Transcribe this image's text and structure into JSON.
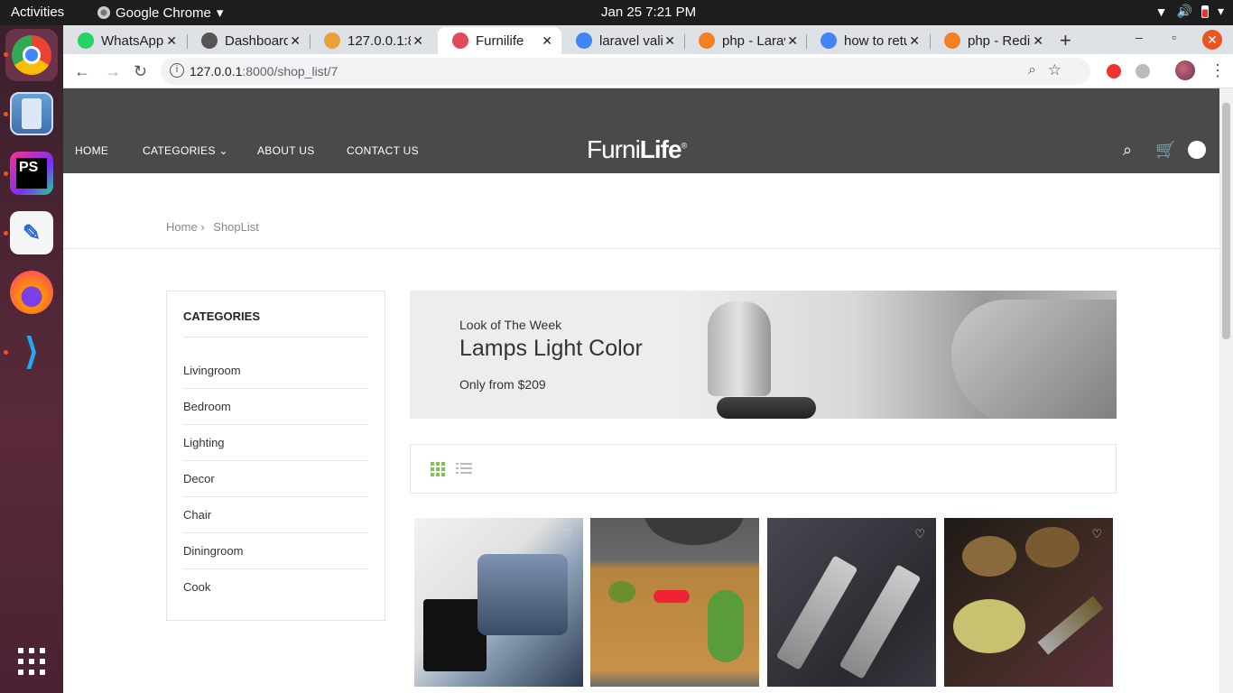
{
  "os": {
    "activities": "Activities",
    "app_name": "Google Chrome",
    "clock": "Jan 25   7:21 PM"
  },
  "browser": {
    "tabs": [
      {
        "title": "WhatsApp",
        "color": "#25d366"
      },
      {
        "title": "Dashboard",
        "color": "#555555"
      },
      {
        "title": "127.0.0.1:8",
        "color": "#e8a23a"
      },
      {
        "title": "Furnilife",
        "color": "#e04a5a",
        "active": true
      },
      {
        "title": "laravel valid",
        "color": "#4285f4"
      },
      {
        "title": "php - Larav",
        "color": "#f48024"
      },
      {
        "title": "how to retu",
        "color": "#4285f4"
      },
      {
        "title": "php - Redir",
        "color": "#f48024"
      }
    ],
    "url_host": "127.0.0.1",
    "url_path": ":8000/shop_list/7"
  },
  "site": {
    "nav": {
      "home": "HOME",
      "categories": "CATEGORIES",
      "about": "ABOUT US",
      "contact": "CONTACT US"
    },
    "logo_part1": "Furni",
    "logo_part2": "Life",
    "logo_mark": "®",
    "breadcrumb": {
      "home": "Home",
      "sep": "›",
      "current": "ShopList"
    },
    "sidebar": {
      "title": "CATEGORIES",
      "items": [
        "Livingroom",
        "Bedroom",
        "Lighting",
        "Decor",
        "Chair",
        "Diningroom",
        "Cook"
      ]
    },
    "banner": {
      "subtitle": "Look of The Week",
      "title": "Lamps Light Color",
      "price": "Only from $209"
    },
    "accent": "#7cc44e",
    "header_bg": "#4a4a4a"
  }
}
